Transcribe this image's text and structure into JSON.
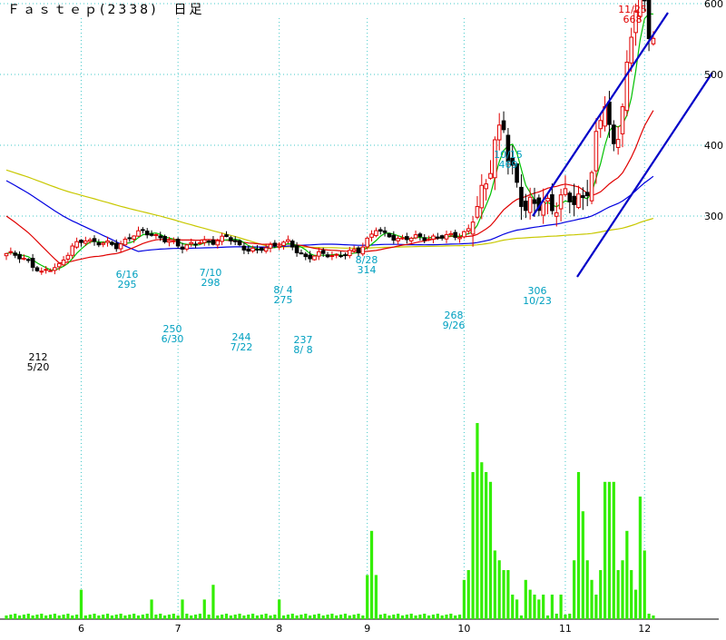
{
  "chart_data": {
    "type": "candlestick",
    "title": "Ｆａｓｔｅｐ(2338)　日足",
    "ylim": [
      200,
      700
    ],
    "y_ticks": [
      "300",
      "400",
      "500",
      "600"
    ],
    "x_ticks": [
      "6",
      "7",
      "8",
      "9",
      "10",
      "11",
      "12"
    ],
    "grid": true,
    "colors": {
      "up": "#e00000",
      "down": "#000000",
      "ma_short": "#00c000",
      "ma_mid": "#e00000",
      "ma_long": "#0000e0",
      "ma_longest": "#c8c800",
      "volume": "#33ee00",
      "channel": "#0000c8",
      "grid": "#40c8c8",
      "annotation_high": "#e00000",
      "annotation_cyan": "#00a0c0",
      "annotation_low": "#000000"
    },
    "annotations": [
      {
        "kind": "low",
        "value": "212",
        "date": "5/20",
        "color": "#000000"
      },
      {
        "kind": "high",
        "value": "295",
        "date": "6/16",
        "color": "#00a0c0"
      },
      {
        "kind": "low",
        "value": "250",
        "date": "6/30",
        "color": "#00a0c0"
      },
      {
        "kind": "high",
        "value": "298",
        "date": "7/10",
        "color": "#00a0c0"
      },
      {
        "kind": "low",
        "value": "244",
        "date": "7/22",
        "color": "#00a0c0"
      },
      {
        "kind": "high",
        "value": "275",
        "date": "8/ 4",
        "color": "#00a0c0"
      },
      {
        "kind": "low",
        "value": "237",
        "date": "8/ 8",
        "color": "#00a0c0"
      },
      {
        "kind": "high",
        "value": "314",
        "date": "8/28",
        "color": "#00a0c0"
      },
      {
        "kind": "low",
        "value": "268",
        "date": "9/26",
        "color": "#00a0c0"
      },
      {
        "kind": "high",
        "value": "469",
        "date": "10/15",
        "color": "#00a0c0"
      },
      {
        "kind": "low",
        "value": "306",
        "date": "10/23",
        "color": "#00a0c0"
      },
      {
        "kind": "high",
        "value": "668",
        "date": "11/25",
        "color": "#e00000"
      }
    ]
  }
}
